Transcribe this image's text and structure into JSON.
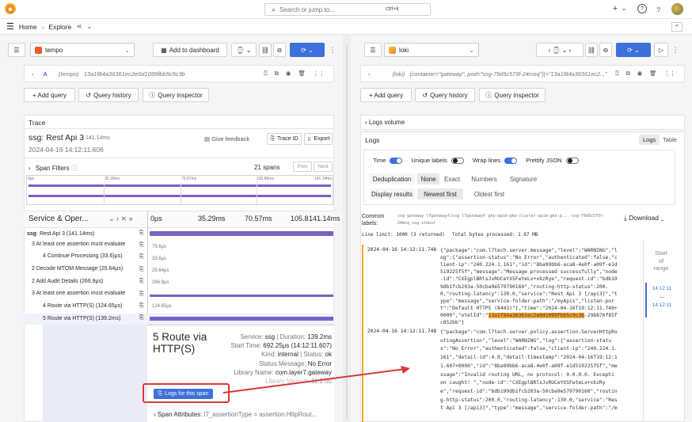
{
  "topbar": {
    "search_placeholder": "Search or jump to...",
    "shortcut": "ctrl+k",
    "plus": "+",
    "plus_chev": "⌄"
  },
  "breadcrumb": {
    "home": "Home",
    "sep": "›",
    "explore": "Explore"
  },
  "left": {
    "datasource": "tempo",
    "add_to_dashboard": "Add to dashboard",
    "query": {
      "letter": "A",
      "source": "(tempo)",
      "value": "13a1f84a36361ec2e0d1099fbb5c9c3b"
    },
    "add_query": "+ Add query",
    "query_history": "Query history",
    "query_inspector": "Query inspector",
    "trace_label": "Trace",
    "trace": {
      "title": "ssg: Rest Api 3",
      "duration": "141.14ms",
      "start": "2024-04-16 14:12:11.606",
      "give_feedback": "Give feedback",
      "trace_id_btn": "Trace ID",
      "export_btn": "Export"
    },
    "span_filters": "Span Filters",
    "spans_count": "21 spans",
    "prev": "Prev",
    "next": "Next",
    "minimap_ticks": [
      "0μs",
      "35.29ms",
      "70.57ms",
      "105.86ms",
      "141.14ms"
    ],
    "col_header": "Service & Oper...",
    "col_ticks": [
      "0μs",
      "35.29ms",
      "70.57ms",
      "105.86ms",
      "141.14ms"
    ],
    "spans": [
      {
        "service": "ssg",
        "op": "Rest Api 3 (141.14ms)",
        "dur": ""
      },
      {
        "service": "",
        "op": "3 At least one assertion must evaluate",
        "dur": "79.6μs"
      },
      {
        "service": "",
        "op": "4 Continue Processing (33.6)μs)",
        "dur": "33.6μs"
      },
      {
        "service": "",
        "op": "2 Decode MTOM Message (25.64μs)",
        "dur": "25.64μs"
      },
      {
        "service": "",
        "op": "2 Add Audit Details (266.9μs)",
        "dur": "266.9μs"
      },
      {
        "service": "",
        "op": "3 At least one assertion must evaluate",
        "dur": ""
      },
      {
        "service": "",
        "op": "4 Route via HTTP(S) (124.65μs)",
        "dur": "124.65μs"
      },
      {
        "service": "",
        "op": "5 Route via HTTP(S) (139.2ms)",
        "dur": ""
      }
    ],
    "detail": {
      "title": "5 Route via HTTP(S)",
      "service_label": "Service:",
      "service": "ssg",
      "duration_label": "Duration:",
      "duration": "139.2ms",
      "start_label": "Start Time:",
      "start": "692.25μs (14:12:11.607)",
      "kind_label": "Kind:",
      "kind": "internal",
      "status_label": "Status:",
      "status": "ok",
      "status_msg_label": "Status Message:",
      "status_msg": "No Error",
      "lib_label": "Library Name:",
      "lib": "com.layer7.gateway",
      "libver_label": "Library Version:",
      "libver": "11.1.00",
      "logs_btn": "Logs for this span",
      "span_attr_label": "Span Attributes:",
      "span_attr_val": "l7_assertionType = assertion:HttpRout..."
    }
  },
  "right": {
    "datasource": "loki",
    "query": {
      "source": "(loki)",
      "value": "{container=\"gateway\", pod=\"ssg-79d5c579f-24msq\"}|=\"13a1f84a36361ec2...\""
    },
    "add_query": "+ Add query",
    "query_history": "Query history",
    "query_inspector": "Query inspector",
    "logs_volume": "Logs volume",
    "logs_title": "Logs",
    "tab_logs": "Logs",
    "tab_table": "Table",
    "opts": {
      "time": "Time",
      "unique": "Unique labels",
      "wrap": "Wrap lines",
      "pretty": "Prettify JSON"
    },
    "dedup_label": "Deduplication",
    "dedup": [
      "None",
      "Exact",
      "Numbers",
      "Signature"
    ],
    "display_label": "Display results",
    "display": [
      "Newest first",
      "Oldest first"
    ],
    "common_label": "Common labels:",
    "common_value": "ssg gateway l7gatewayf/ssg l7gatewayf gke-apim-gke-cluster-apim-gke-p... ssg-79d5c579f-24msq ssg stdout",
    "download": "Download",
    "limit": "Line limit: 1000 (3 returned)",
    "bytes": "Total bytes processed: 1.97 MB",
    "log1_ts": "2024-04-16 14:12:11.748",
    "log1": [
      "{\"package\":\"com.l7tech.server.message\",\"level\":\"WARNING\",\"l",
      "og\":{\"assertion-status\":\"No Error\",\"authenticated\":false,\"c",
      "lient-ip\":\"240.224.1.161\",\"id\":\"8ba99bb6-aca8-4e0f-a09f-e1d",
      "519225f5f\",\"message\":\"Message processed successfully\",\"node",
      "-id\":\"CXEgplBRlsJxRUCeYXSFwteLx+xkzRye\",\"request-id\":\"bdb19",
      "9db1fcb203a-50cba9e579790160\",\"routing-http-status\":200.",
      "0,\"routing-latency\":139.0,\"service\":\"Rest Api 3 [/api3]\",\"t",
      "ype\":\"message\",\"service-folder-path\":\"/myApis\",\"listen-por",
      "t\":\"Default HTTPS (8443)\"},\"time\":\"2024-04-16T19:12:11.748+",
      "0000\",\"otelId\":\""
    ],
    "log1_otel": "13a1f84a36361ec2e0d1099fbb5c9c3b",
    "log1_tail": "-29b876f85f",
    "log1_end": "c852bb\"}",
    "log2_ts": "2024-04-16 14:12:11.748",
    "log2": [
      "{\"package\":\"com.l7tech.server.policy.assertion.ServerHttpRo",
      "utingAssertion\",\"level\":\"WARNING\",\"log\":{\"assertion-statu",
      "s\":\"No Error\",\"authenticated\":false,\"client-ip\":\"240.224.1.",
      "161\",\"detail-id\":4.0,\"detail-timestamp\":\"2024-04-16T19:12:1",
      "1.607+0000\",\"id\":\"8ba99bb6-aca8-4e0f-a09f-e1d519225f5f\",\"me",
      "ssage\":\"Invalid routing URL, no protocol: 0.0.0.0. Excepti",
      "on caught! \",\"node-id\":\"CXEgplBRlsJxRUCeYXSFwteLx+xkzRy",
      "e\",\"request-id\":\"bdb199db1fcb203a-50cba9e579790160\",\"routin",
      "g-http-status\":200.0,\"routing-latency\":139.0,\"service\":\"Res",
      "t Api 3 [/api3]\",\"type\":\"message\",\"service-folder-path\":\"/m"
    ],
    "range": {
      "start": "Start",
      "of": "of",
      "range": "range",
      "t1": "14:12:11",
      "dash": "—",
      "t2": "14:12:11"
    }
  },
  "colors": {
    "accent": "#3d71d9",
    "highlight": "#f5a42d",
    "annotation": "#d93838",
    "span_bar": "#7b61c4"
  }
}
